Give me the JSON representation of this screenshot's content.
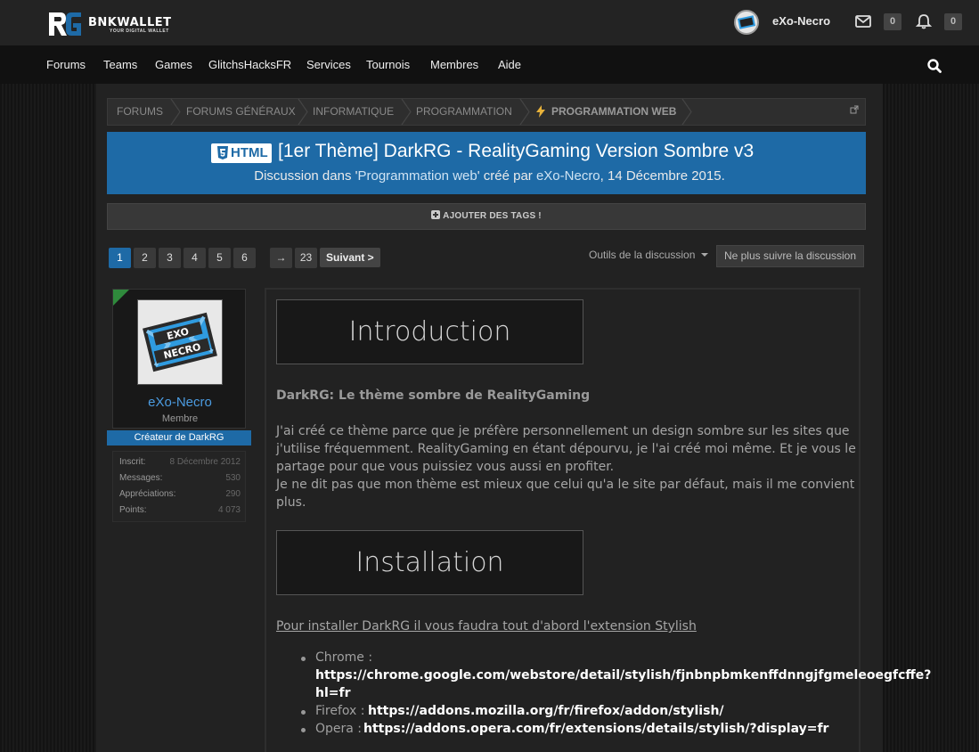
{
  "header": {
    "logo_name": "BNKWALLET",
    "logo_tagline": "YOUR DIGITAL WALLET",
    "username": "eXo-Necro",
    "messages_count": "0",
    "alerts_count": "0"
  },
  "nav": {
    "items": [
      "Forums",
      "Teams",
      "Games",
      "GlitchsHacksFR",
      "Services",
      "Tournois",
      "Membres",
      "Aide"
    ]
  },
  "breadcrumb": [
    "Forums",
    "Forums généraux",
    "Informatique",
    "Programmation",
    "Programmation web"
  ],
  "thread": {
    "prefix": "HTML",
    "title": "[1er Thème] DarkRG - RealityGaming Version Sombre v3",
    "meta_prefix": "Discussion dans '",
    "meta_forum": "Programmation web",
    "meta_mid": "' créé par ",
    "meta_author": "eXo-Necro",
    "meta_date": ", 14 Décembre 2015."
  },
  "tags_label": "AJOUTER DES TAGS !",
  "pagination": {
    "pages": [
      "1",
      "2",
      "3",
      "4",
      "5",
      "6"
    ],
    "current": "1",
    "arrow": "→",
    "last": "23",
    "next_label": "Suivant >"
  },
  "thread_tools_label": "Outils de la discussion",
  "unwatch_label": "Ne plus suivre la discussion",
  "author": {
    "name": "eXo-Necro",
    "role": "Membre",
    "banner": "Créateur de DarkRG",
    "stats": [
      {
        "label": "Inscrit:",
        "value": "8 Décembre 2012"
      },
      {
        "label": "Messages:",
        "value": "530"
      },
      {
        "label": "Appréciations:",
        "value": "290"
      },
      {
        "label": "Points:",
        "value": "4 073"
      }
    ]
  },
  "post": {
    "heading1": "Introduction",
    "subtitle": "DarkRG: Le thème sombre de RealityGaming",
    "lines": [
      "J'ai créé ce thème parce que je préfère personnellement un design sombre sur les sites que",
      "j'utilise fréquemment. RealityGaming en étant dépourvu, je l'ai créé moi même. Et je vous le",
      "partage pour que vous puissiez vous aussi en profiter.",
      "Je ne dit pas que mon thème est mieux que celui qu'a le site par défaut, mais il me convient",
      "plus."
    ],
    "heading2": "Installation",
    "install_intro": "Pour installer DarkRG il vous faudra tout d'abord l'extension Stylish",
    "links": [
      {
        "label": "Chrome :",
        "url_line1": "https://chrome.google.com/webstore/detail/stylish/fjnbnpbmkenffdnngjfgmeleoegfcffe?",
        "url_line2": "hl=fr"
      },
      {
        "label": "Firefox :",
        "url": "https://addons.mozilla.org/fr/firefox/addon/stylish/"
      },
      {
        "label": "Opera :",
        "url": "https://addons.opera.com/fr/extensions/details/stylish/?display=fr"
      }
    ]
  }
}
